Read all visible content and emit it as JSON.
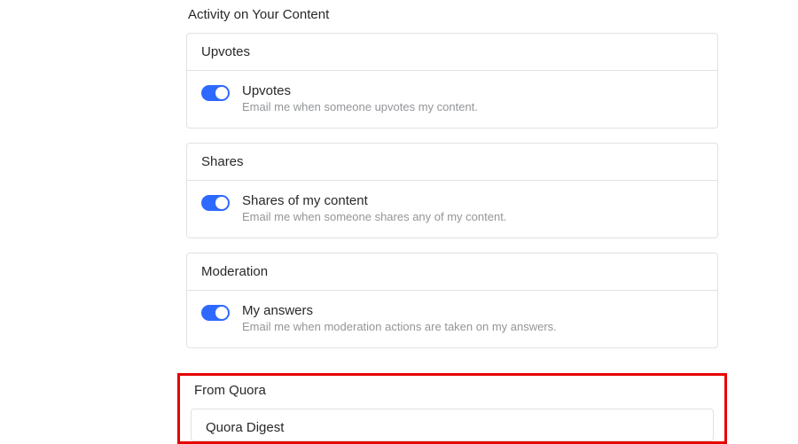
{
  "sections": {
    "activity": {
      "title": "Activity on Your Content",
      "cards": [
        {
          "header": "Upvotes",
          "item_label": "Upvotes",
          "item_desc": "Email me when someone upvotes my content.",
          "toggle_on": true
        },
        {
          "header": "Shares",
          "item_label": "Shares of my content",
          "item_desc": "Email me when someone shares any of my content.",
          "toggle_on": true
        },
        {
          "header": "Moderation",
          "item_label": "My answers",
          "item_desc": "Email me when moderation actions are taken on my answers.",
          "toggle_on": true
        }
      ]
    },
    "from_quora": {
      "title": "From Quora",
      "cards": [
        {
          "header": "Quora Digest"
        }
      ]
    }
  },
  "colors": {
    "toggle_on": "#2e69ff",
    "highlight_border": "#e60000",
    "text_primary": "#282829",
    "text_secondary": "#939598",
    "card_border": "#e2e2e2"
  }
}
